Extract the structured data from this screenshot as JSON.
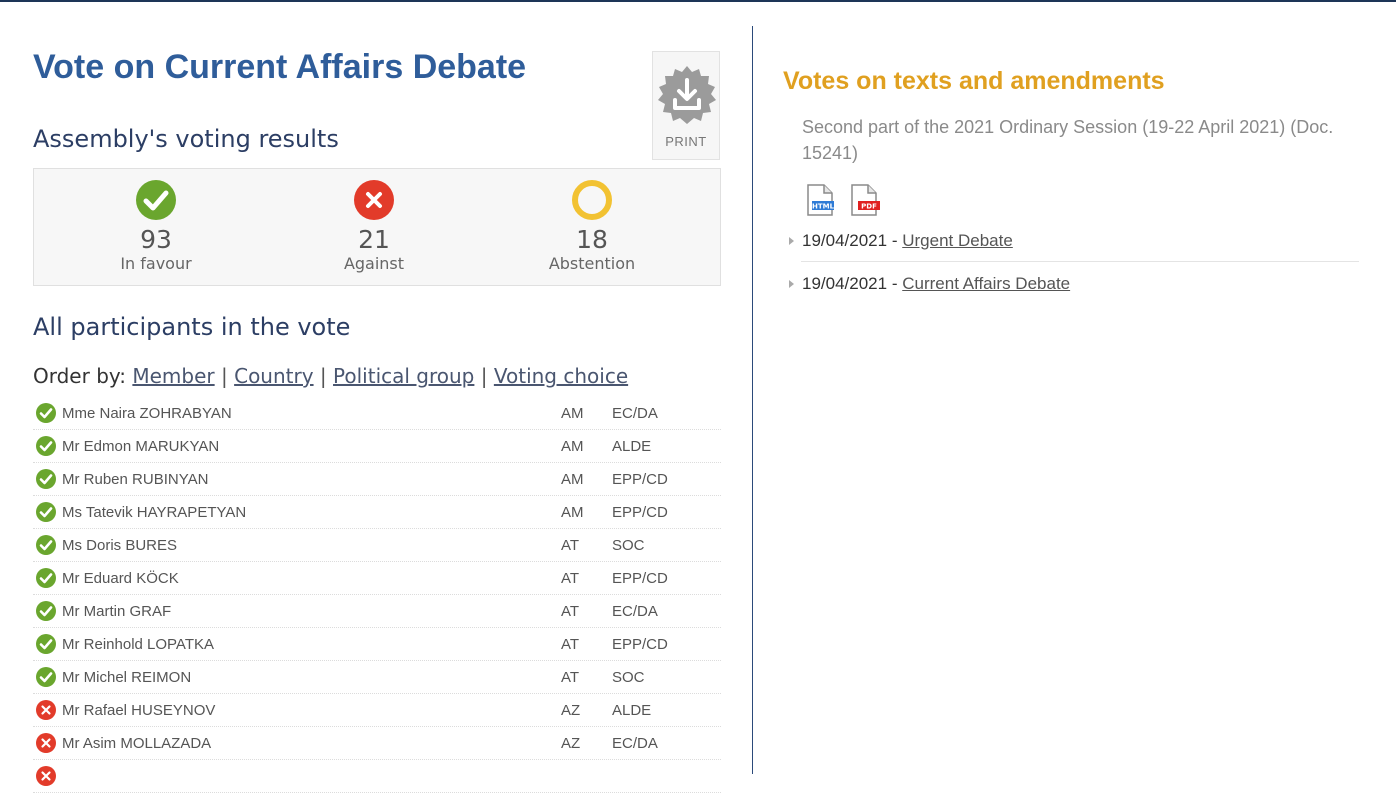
{
  "page": {
    "title": "Vote on Current Affairs Debate",
    "print_label": "PRINT"
  },
  "results": {
    "heading": "Assembly's voting results",
    "in_favour": {
      "count": "93",
      "label": "In favour",
      "color": "#6aa62e"
    },
    "against": {
      "count": "21",
      "label": "Against",
      "color": "#e23b2a"
    },
    "abstention": {
      "count": "18",
      "label": "Abstention",
      "color": "#f2c232"
    }
  },
  "participants": {
    "heading": "All participants in the vote",
    "order_by_label": "Order by:",
    "order_options": [
      "Member",
      "Country",
      "Political group",
      "Voting choice"
    ],
    "separator": "|",
    "rows": [
      {
        "vote": "for",
        "name": "Mme Naira ZOHRABYAN",
        "country": "AM",
        "group": "EC/DA"
      },
      {
        "vote": "for",
        "name": "Mr Edmon MARUKYAN",
        "country": "AM",
        "group": "ALDE"
      },
      {
        "vote": "for",
        "name": "Mr Ruben RUBINYAN",
        "country": "AM",
        "group": "EPP/CD"
      },
      {
        "vote": "for",
        "name": "Ms Tatevik HAYRAPETYAN",
        "country": "AM",
        "group": "EPP/CD"
      },
      {
        "vote": "for",
        "name": "Ms Doris BURES",
        "country": "AT",
        "group": "SOC"
      },
      {
        "vote": "for",
        "name": "Mr Eduard KÖCK",
        "country": "AT",
        "group": "EPP/CD"
      },
      {
        "vote": "for",
        "name": "Mr Martin GRAF",
        "country": "AT",
        "group": "EC/DA"
      },
      {
        "vote": "for",
        "name": "Mr Reinhold LOPATKA",
        "country": "AT",
        "group": "EPP/CD"
      },
      {
        "vote": "for",
        "name": "Mr Michel REIMON",
        "country": "AT",
        "group": "SOC"
      },
      {
        "vote": "against",
        "name": "Mr Rafael HUSEYNOV",
        "country": "AZ",
        "group": "ALDE"
      },
      {
        "vote": "against",
        "name": "Mr Asim MOLLAZADA",
        "country": "AZ",
        "group": "EC/DA"
      },
      {
        "vote": "against",
        "name": "",
        "country": "",
        "group": ""
      }
    ]
  },
  "votes_panel": {
    "title": "Votes on texts and amendments",
    "session": "Second part of the 2021 Ordinary Session (19-22 April 2021) (Doc. 15241)",
    "doc_icons": [
      {
        "icon": "html-file-icon",
        "label": "HTML"
      },
      {
        "icon": "pdf-file-icon",
        "label": "PDF"
      }
    ],
    "items": [
      {
        "date": "19/04/2021",
        "dash": "-",
        "link": "Urgent Debate "
      },
      {
        "date": "19/04/2021",
        "dash": "-",
        "link": "Current Affairs Debate "
      }
    ]
  }
}
